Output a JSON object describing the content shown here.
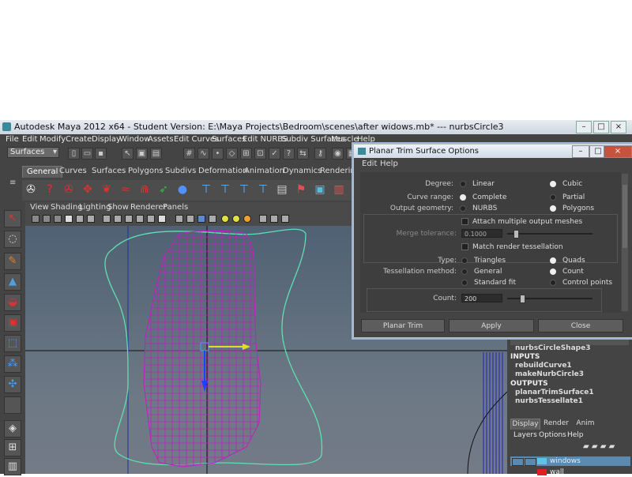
{
  "window": {
    "title": "Autodesk Maya 2012 x64 - Student Version: E:\\Maya Projects\\Bedroom\\scenes\\after widows.mb*   ---   nurbsCircle3"
  },
  "menubar": [
    "File",
    "Edit",
    "Modify",
    "Create",
    "Display",
    "Window",
    "Assets",
    "Edit Curves",
    "Surfaces",
    "Edit NURBS",
    "Subdiv Surfaces",
    "Muscle",
    "Help"
  ],
  "status": {
    "menuset": "Surfaces"
  },
  "shelf": {
    "tabs": [
      "General",
      "Curves",
      "Surfaces",
      "Polygons",
      "Subdivs",
      "Deformation",
      "Animation",
      "Dynamics",
      "Rendering"
    ],
    "active": "General"
  },
  "panel": {
    "menus": [
      "View",
      "Shading",
      "Lighting",
      "Show",
      "Renderer",
      "Panels"
    ]
  },
  "dialog": {
    "title": "Planar Trim Surface Options",
    "menus": [
      "Edit",
      "Help"
    ],
    "degree": {
      "label": "Degree:",
      "options": [
        "Linear",
        "Cubic"
      ],
      "selected": "Cubic"
    },
    "curve_range": {
      "label": "Curve range:",
      "options": [
        "Complete",
        "Partial"
      ],
      "selected": "Complete"
    },
    "output_geometry": {
      "label": "Output geometry:",
      "options": [
        "NURBS",
        "Polygons"
      ],
      "selected": "Polygons"
    },
    "attach_multiple": "Attach multiple output meshes",
    "merge_tolerance": {
      "label": "Merge tolerance:",
      "value": "0.1000"
    },
    "match_render": "Match render tessellation",
    "type": {
      "label": "Type:",
      "options": [
        "Triangles",
        "Quads"
      ],
      "selected": "Quads"
    },
    "tessellation_method": {
      "label": "Tessellation method:",
      "options": [
        "General",
        "Count",
        "Standard fit",
        "Control points"
      ],
      "selected": "Count"
    },
    "count": {
      "label": "Count:",
      "value": "200",
      "level": 0.15
    },
    "buttons": [
      "Planar Trim",
      "Apply",
      "Close"
    ]
  },
  "channel_box": {
    "shape": "nurbsCircleShape3",
    "inputs_label": "INPUTS",
    "inputs": [
      "rebuildCurve1",
      "makeNurbCircle3"
    ],
    "outputs_label": "OUTPUTS",
    "outputs": [
      "planarTrimSurface1",
      "nurbsTessellate1"
    ]
  },
  "layer_editor": {
    "tabs": [
      "Display",
      "Render",
      "Anim"
    ],
    "active": "Display",
    "menus": [
      "Layers",
      "Options",
      "Help"
    ],
    "layers": [
      {
        "name": "windows",
        "color": "#5fc3e6"
      },
      {
        "name": "wall",
        "color": "#e02020"
      }
    ]
  },
  "colors": {
    "panel": "#444444",
    "viewport_top": "#4f6173",
    "curve": "#5fe0b0",
    "mesh": "#c020c0"
  }
}
